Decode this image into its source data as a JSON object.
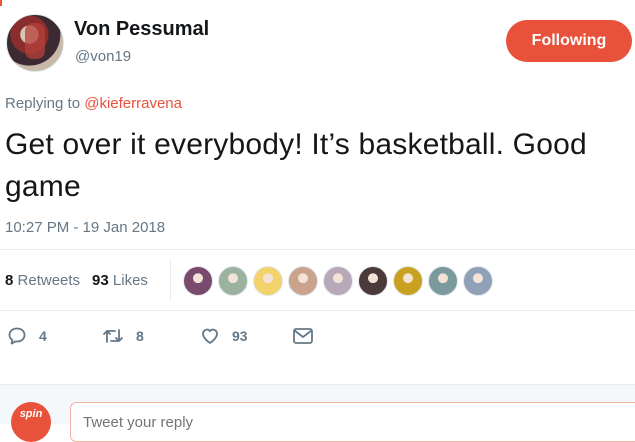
{
  "author": {
    "name": "Von Pessumal",
    "handle": "@von19",
    "follow_button": "Following"
  },
  "reply_context": {
    "prefix": "Replying to",
    "mention": "@kieferravena"
  },
  "tweet": {
    "text": "Get over it everybody! It’s basketball. Good game",
    "timestamp": "10:27 PM - 19 Jan 2018"
  },
  "stats": {
    "retweets_count": "8",
    "retweets_label": "Retweets",
    "likes_count": "93",
    "likes_label": "Likes"
  },
  "likers": [
    {
      "color": "#7a4a6e"
    },
    {
      "color": "#9bb39e"
    },
    {
      "color": "#f2d36b"
    },
    {
      "color": "#c9a38b"
    },
    {
      "color": "#b7a9b8"
    },
    {
      "color": "#4b3a3a"
    },
    {
      "color": "#c9a020"
    },
    {
      "color": "#7b9a9c"
    },
    {
      "color": "#8fa1b6"
    }
  ],
  "actions": {
    "reply_count": "4",
    "retweet_count": "8",
    "like_count": "93"
  },
  "reply_box": {
    "placeholder": "Tweet your reply",
    "avatar_text": "spin"
  },
  "colors": {
    "accent": "#e8513a",
    "secondary_text": "#657786"
  },
  "icons": [
    "reply-icon",
    "retweet-icon",
    "heart-icon",
    "envelope-icon"
  ]
}
